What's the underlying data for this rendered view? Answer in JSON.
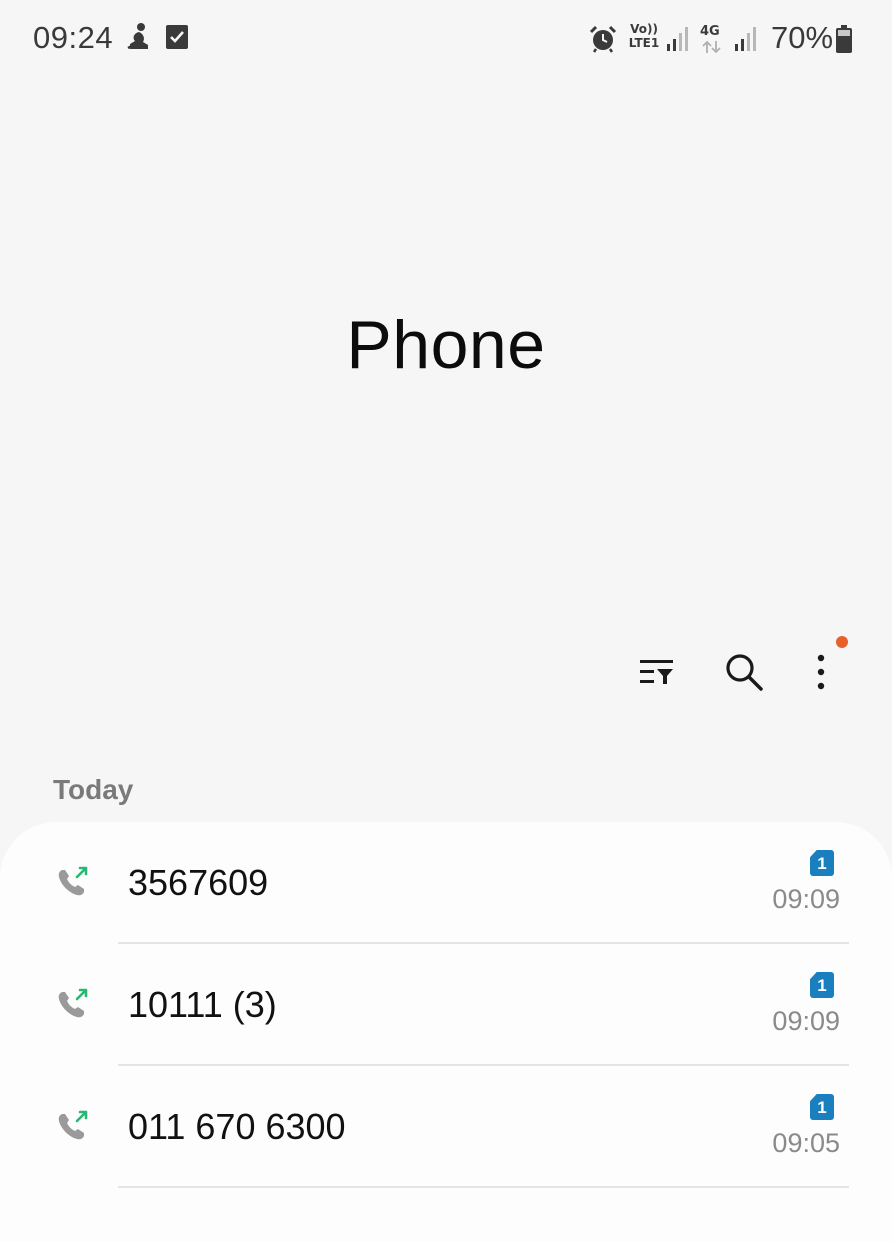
{
  "status_bar": {
    "time": "09:24",
    "left_icons": [
      "meditation-icon",
      "checkbox-icon"
    ],
    "right_icons": [
      "alarm-icon",
      "volte-icon",
      "signal-icon",
      "4g-icon",
      "signal-icon",
      "battery-icon"
    ],
    "volte_line1": "Vo))",
    "volte_line2": "LTE1",
    "network_label": "4G",
    "battery": "70%"
  },
  "header": {
    "title": "Phone"
  },
  "toolbar": {
    "icons": [
      "filter-icon",
      "search-icon",
      "more-options-icon"
    ],
    "notification_dot_color": "#e8602c"
  },
  "sections": [
    {
      "label": "Today",
      "calls": [
        {
          "number": "3567609",
          "sim": "1",
          "time": "09:09",
          "type": "outgoing"
        },
        {
          "number": "10111 (3)",
          "sim": "1",
          "time": "09:09",
          "type": "outgoing"
        },
        {
          "number": "011 670 6300",
          "sim": "1",
          "time": "09:05",
          "type": "outgoing"
        }
      ]
    }
  ],
  "colors": {
    "background": "#f6f6f6",
    "card": "#fdfdfd",
    "sim_badge": "#1a7fbf",
    "outgoing_arrow": "#2bb673",
    "phone_icon": "#9a9a9a"
  }
}
